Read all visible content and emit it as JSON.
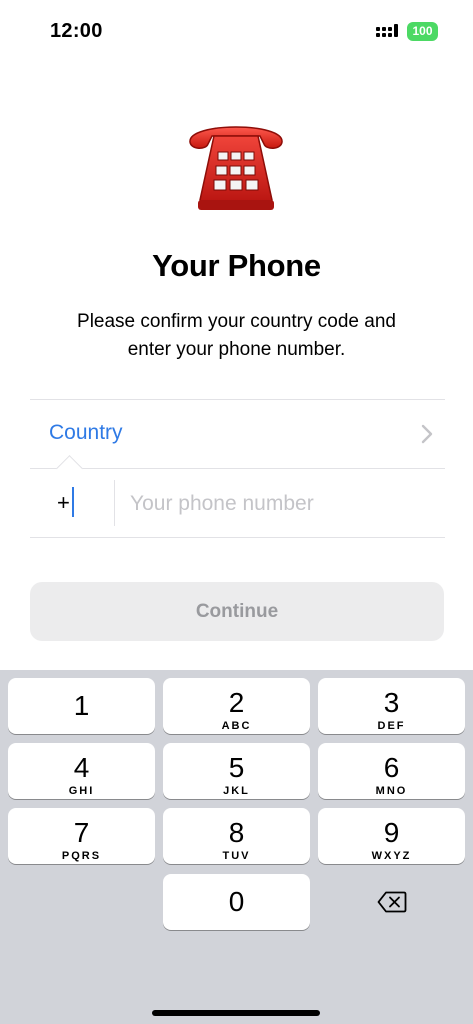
{
  "status_bar": {
    "time": "12:00",
    "battery": "100"
  },
  "header": {
    "emoji_icon": "red-telephone-icon",
    "title": "Your Phone",
    "subtitle": "Please confirm your country code and enter your phone number."
  },
  "form": {
    "country_label": "Country",
    "country_code_prefix": "+",
    "phone_placeholder": "Your phone number",
    "phone_value": "",
    "continue_label": "Continue"
  },
  "colors": {
    "accent": "#2f7ae5",
    "battery": "#4cd964",
    "button_disabled_bg": "#ececed",
    "keypad_bg": "#d1d3d9"
  },
  "keypad": {
    "keys": [
      {
        "digit": "1",
        "letters": ""
      },
      {
        "digit": "2",
        "letters": "ABC"
      },
      {
        "digit": "3",
        "letters": "DEF"
      },
      {
        "digit": "4",
        "letters": "GHI"
      },
      {
        "digit": "5",
        "letters": "JKL"
      },
      {
        "digit": "6",
        "letters": "MNO"
      },
      {
        "digit": "7",
        "letters": "PQRS"
      },
      {
        "digit": "8",
        "letters": "TUV"
      },
      {
        "digit": "9",
        "letters": "WXYZ"
      },
      {
        "digit": "0",
        "letters": ""
      }
    ],
    "delete_icon": "backspace-icon"
  }
}
